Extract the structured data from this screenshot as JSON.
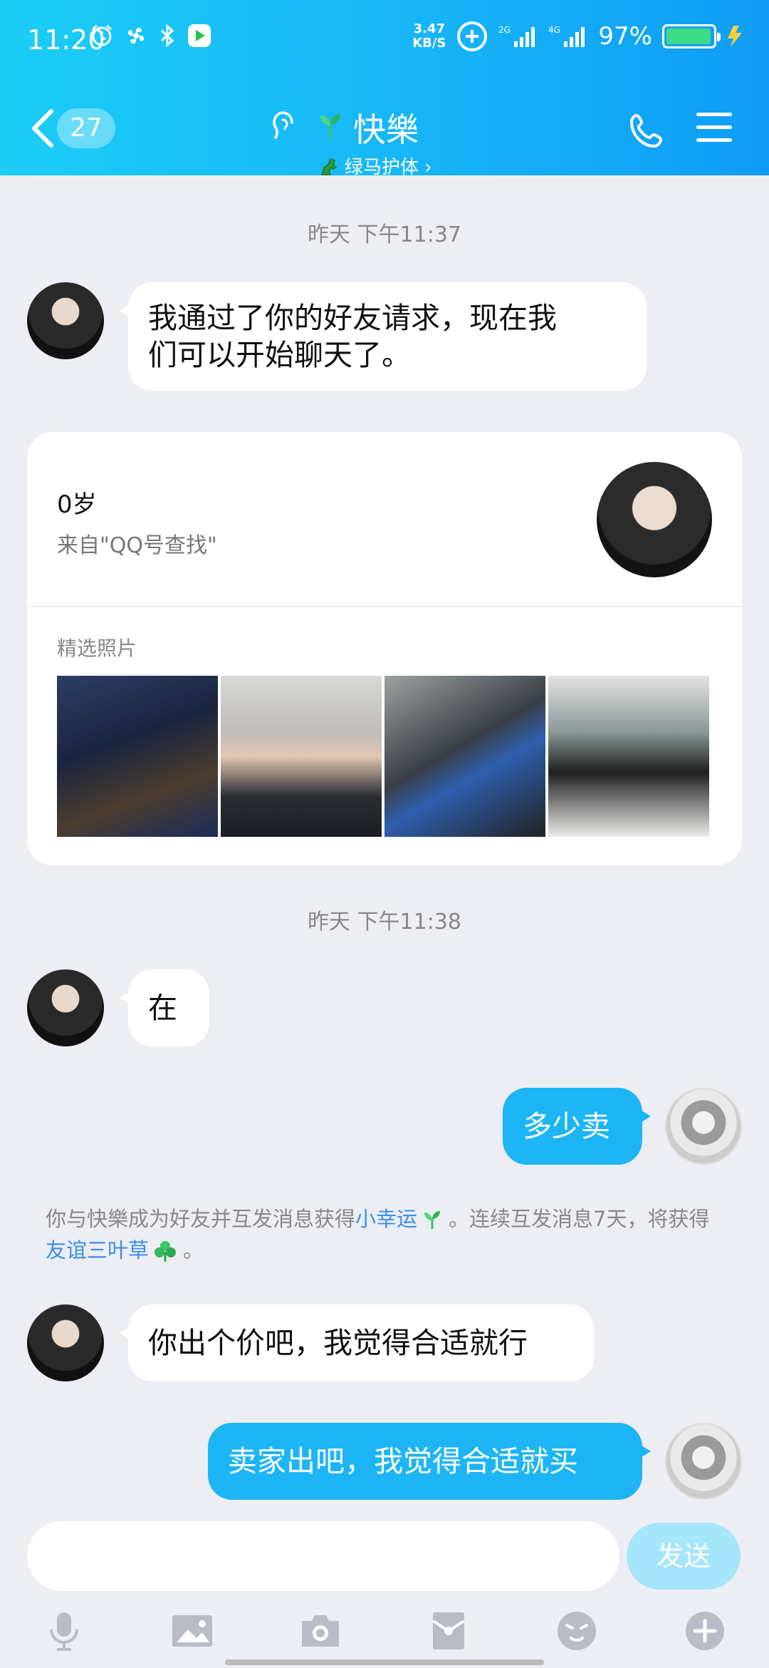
{
  "status_bar": {
    "time": "11:20",
    "net_speed_value": "3.47",
    "net_speed_unit": "KB/S",
    "sig1": "2G",
    "sig2": "4G",
    "battery_pct": "97%",
    "battery_level": 0.97
  },
  "nav": {
    "unread_count": "27",
    "title": "快樂",
    "subtitle": "绿马护体 ›"
  },
  "timestamps": [
    "昨天 下午11:37",
    "昨天 下午11:38"
  ],
  "messages": [
    {
      "side": "in",
      "text_line1": "我通过了你的好友请求，现在我",
      "text_line2": "们可以开始聊天了。"
    },
    {
      "side": "in",
      "text": "在"
    },
    {
      "side": "out",
      "text": "多少卖"
    },
    {
      "side": "in",
      "text": "你出个价吧，我觉得合适就行"
    },
    {
      "side": "out",
      "text": "卖家出吧，我觉得合适就买"
    }
  ],
  "profile_card": {
    "age": "0岁",
    "source": "来自\"QQ号查找\"",
    "photos_label": "精选照片"
  },
  "notice": {
    "part1": "你与快樂成为好友并互发消息获得",
    "link1": "小幸运",
    "part2": "。连续互发消息7天，将获得",
    "link2": "友谊三叶草",
    "part3": "。"
  },
  "input": {
    "placeholder": "",
    "send_label": "发送"
  },
  "toolbar_icons": [
    "microphone-icon",
    "image-icon",
    "camera-icon",
    "red-packet-icon",
    "emoji-icon",
    "plus-icon"
  ]
}
